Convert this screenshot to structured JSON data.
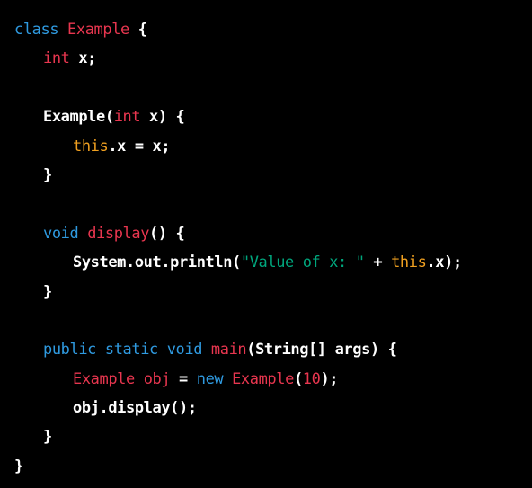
{
  "code": {
    "line1": {
      "t1": "class",
      "t2": " ",
      "t3": "Example",
      "t4": " {"
    },
    "line2": {
      "t1": "int",
      "t2": " x;"
    },
    "line4": {
      "t1": "Example(",
      "t2": "int",
      "t3": " x) {"
    },
    "line5": {
      "t1": "this",
      "t2": ".x = x;"
    },
    "line6": {
      "t1": "}"
    },
    "line8": {
      "t1": "void",
      "t2": " ",
      "t3": "display",
      "t4": "() {"
    },
    "line9": {
      "t1": "System.out.println(",
      "t2": "\"Value of x: \"",
      "t3": " + ",
      "t4": "this",
      "t5": ".x);"
    },
    "line10": {
      "t1": "}"
    },
    "line12": {
      "t1": "public",
      "t2": " ",
      "t3": "static",
      "t4": " ",
      "t5": "void",
      "t6": " ",
      "t7": "main",
      "t8": "(String[] args) {"
    },
    "line13": {
      "t1": "Example",
      "t2": " ",
      "t3": "obj",
      "t4": " = ",
      "t5": "new",
      "t6": " ",
      "t7": "Example",
      "t8": "(",
      "t9": "10",
      "t10": ");"
    },
    "line14": {
      "t1": "obj.display();"
    },
    "line15": {
      "t1": "}"
    },
    "line16": {
      "t1": "}"
    }
  },
  "colors": {
    "background": "#000000",
    "keyword_blue": "#2f9ae0",
    "identifier_red": "#e8364f",
    "this_orange": "#f0a020",
    "string_green": "#00a67d",
    "text": "#ffffff"
  }
}
